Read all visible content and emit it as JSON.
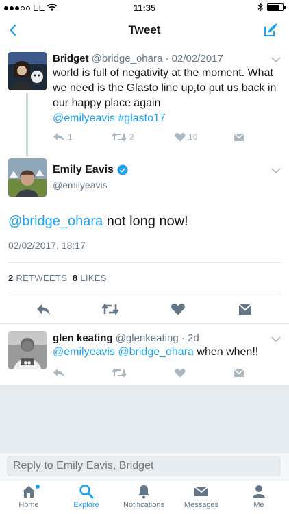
{
  "status": {
    "carrier": "EE",
    "time": "11:35",
    "battery_level": 0.8
  },
  "nav": {
    "title": "Tweet"
  },
  "parent_tweet": {
    "name": "Bridget",
    "handle": "@bridge_ohara",
    "date": "· 02/02/2017",
    "text": "world is full of negativity at the moment. What we need is the Glasto line up,to put us back in our happy place again",
    "mentions": "@emilyeavis",
    "hashtag": "#glasto17",
    "reply_count": "1",
    "retweet_count": "2",
    "like_count": "10"
  },
  "main_tweet": {
    "name": "Emily Eavis",
    "handle": "@emilyeavis",
    "mention": "@bridge_ohara",
    "text": " not long now!",
    "timestamp": "02/02/2017, 18:17",
    "retweets": "2",
    "retweets_label": "RETWEETS",
    "likes": "8",
    "likes_label": "LIKES"
  },
  "reply_tweet": {
    "name": "glen keating",
    "handle": "@glenkeating",
    "date": "· 2d",
    "mention1": "@emilyeavis",
    "mention2": "@bridge_ohara",
    "text": " when when!!"
  },
  "reply_box": {
    "placeholder": "Reply to Emily Eavis, Bridget"
  },
  "tabs": [
    {
      "label": "Home",
      "icon": "home-icon"
    },
    {
      "label": "Explore",
      "icon": "search-icon"
    },
    {
      "label": "Notifications",
      "icon": "bell-icon"
    },
    {
      "label": "Messages",
      "icon": "envelope-icon"
    },
    {
      "label": "Me",
      "icon": "person-icon"
    }
  ],
  "colors": {
    "accent": "#1da1f2",
    "text": "#14171a",
    "secondary": "#657786",
    "icon_gray": "#aab8c2",
    "background_gray": "#e6ecf0"
  }
}
